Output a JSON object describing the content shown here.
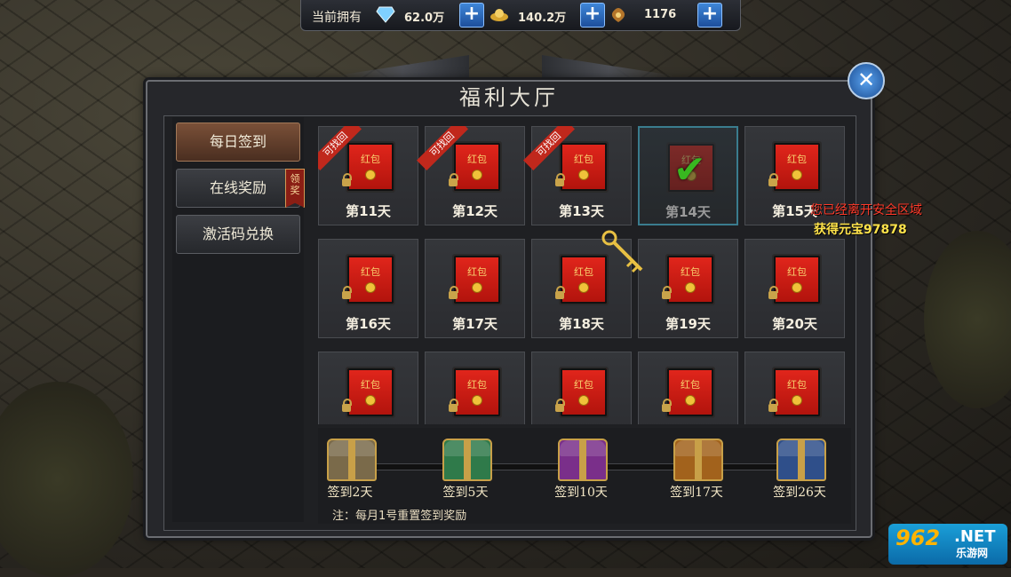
{
  "currency": {
    "label": "当前拥有",
    "items": [
      {
        "icon": "diamond-icon",
        "value": "62.0万"
      },
      {
        "icon": "gold-ingot-icon",
        "value": "140.2万"
      },
      {
        "icon": "coin-bag-icon",
        "value": "1176"
      }
    ],
    "plus": "+"
  },
  "panel": {
    "title": "福利大厅",
    "close": "✕"
  },
  "menu": {
    "items": [
      {
        "label": "每日签到",
        "active": true
      },
      {
        "label": "在线奖励",
        "badge": "领奖"
      },
      {
        "label": "激活码兑换"
      }
    ]
  },
  "signin": {
    "envelope_text": "红包",
    "retrieve_tag": "可找回",
    "days": [
      {
        "label": "第11天",
        "state": "retrievable"
      },
      {
        "label": "第12天",
        "state": "retrievable"
      },
      {
        "label": "第13天",
        "state": "retrievable"
      },
      {
        "label": "第14天",
        "state": "claimed"
      },
      {
        "label": "第15天",
        "state": "locked"
      },
      {
        "label": "第16天",
        "state": "locked"
      },
      {
        "label": "第17天",
        "state": "locked"
      },
      {
        "label": "第18天",
        "state": "locked"
      },
      {
        "label": "第19天",
        "state": "locked"
      },
      {
        "label": "第20天",
        "state": "locked"
      },
      {
        "label": "",
        "state": "locked"
      },
      {
        "label": "",
        "state": "locked"
      },
      {
        "label": "",
        "state": "locked"
      },
      {
        "label": "",
        "state": "locked"
      },
      {
        "label": "",
        "state": "locked"
      }
    ]
  },
  "rewards": {
    "chests": [
      {
        "label": "签到2天",
        "color": "#7a6a4a"
      },
      {
        "label": "签到5天",
        "color": "#2f7a4a"
      },
      {
        "label": "签到10天",
        "color": "#7a2f8a"
      },
      {
        "label": "签到17天",
        "color": "#a2621c"
      },
      {
        "label": "签到26天",
        "color": "#2f4f8a"
      }
    ],
    "note": "注：每月1号重置签到奖励"
  },
  "messages": {
    "line1": "您已经离开安全区域",
    "line2": "获得元宝97878"
  },
  "watermark": {
    "big": "962",
    "net": ".NET",
    "cn": "乐游网"
  }
}
